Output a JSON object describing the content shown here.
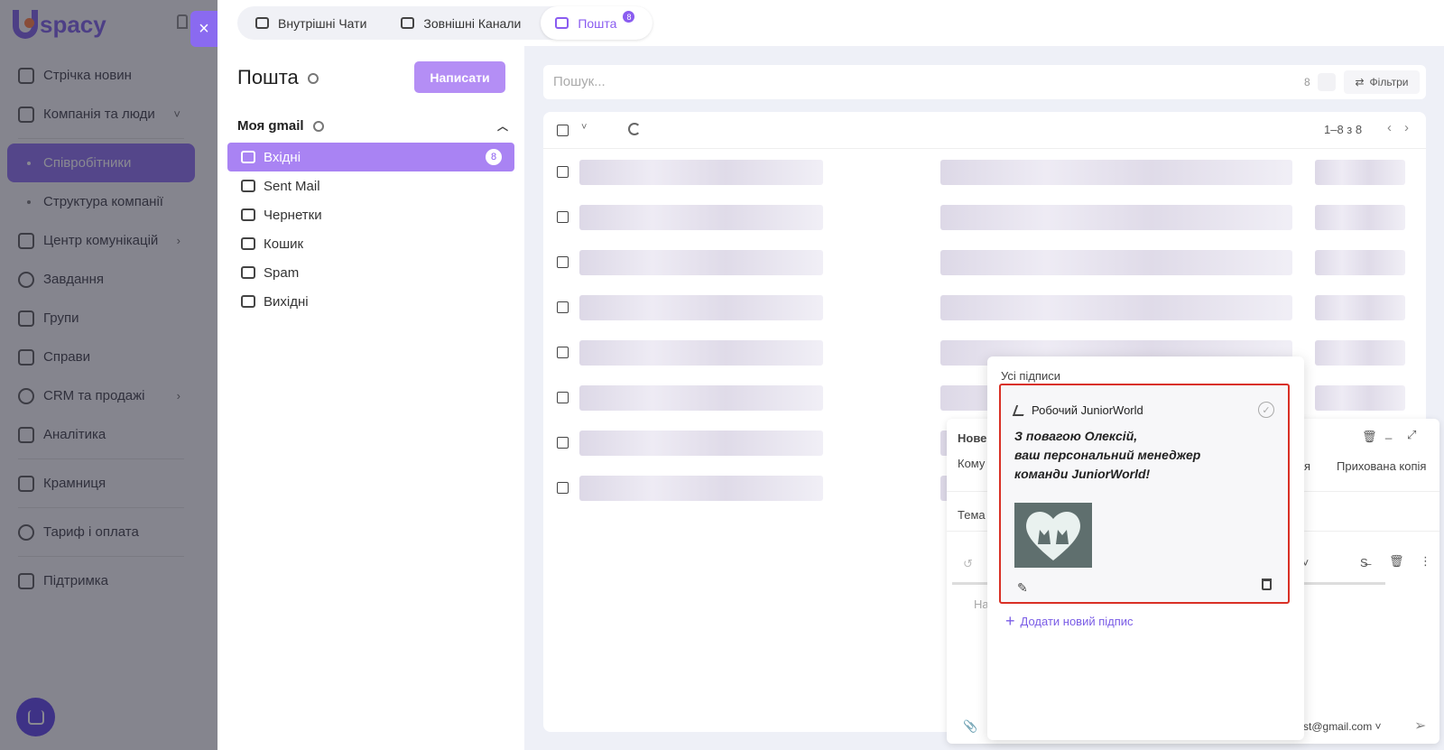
{
  "app": {
    "logo_text": "spacy",
    "nav": [
      {
        "label": "Стрічка новин",
        "type": "item"
      },
      {
        "label": "Компанія та люди",
        "type": "item",
        "chevron": "˅"
      },
      {
        "label": "Співробітники",
        "type": "sub",
        "active": true
      },
      {
        "label": "Структура компанії",
        "type": "sub"
      },
      {
        "label": "Центр комунікацій",
        "type": "item",
        "chevron": "›"
      },
      {
        "label": "Завдання",
        "type": "item"
      },
      {
        "label": "Групи",
        "type": "item"
      },
      {
        "label": "Справи",
        "type": "item"
      },
      {
        "label": "CRM та продажі",
        "type": "item",
        "chevron": "›"
      },
      {
        "label": "Аналітика",
        "type": "item"
      },
      {
        "label": "Крамниця",
        "type": "item"
      },
      {
        "label": "Тариф і оплата",
        "type": "item"
      },
      {
        "label": "Підтримка",
        "type": "item"
      }
    ],
    "close_icon": "×"
  },
  "tabs": [
    {
      "label": "Внутрішні Чати"
    },
    {
      "label": "Зовнішні Канали"
    },
    {
      "label": "Пошта",
      "badge": "8",
      "active": true
    }
  ],
  "mail": {
    "title": "Пошта",
    "compose_label": "Написати",
    "account": "Моя gmail",
    "folders": [
      {
        "label": "Вхідні",
        "count": "8",
        "active": true
      },
      {
        "label": "Sent Mail"
      },
      {
        "label": "Чернетки"
      },
      {
        "label": "Кошик"
      },
      {
        "label": "Spam"
      },
      {
        "label": "Вихідні"
      }
    ]
  },
  "search": {
    "placeholder": "Пошук...",
    "count": "8",
    "filters_label": "Фільтри"
  },
  "list": {
    "pager": "1–8 з 8",
    "rows": 8
  },
  "compose": {
    "title_partial": "Нове",
    "to_label": "Кому",
    "subject_label": "Тема",
    "body_placeholder_partial": "На",
    "cc_partial": "я",
    "bcc_label": "Прихована копія",
    "sender_partial": "st@gmail.com"
  },
  "signatures": {
    "title": "Усі підписи",
    "card": {
      "name": "Робочий JuniorWorld",
      "lines": [
        "З повагою Олексій,",
        "ваш персональний менеджер",
        "команди JuniorWorld!"
      ]
    },
    "add_label": "Додати новий підпис"
  },
  "colors": {
    "accent": "#8a5cf0",
    "highlight_border": "#d93025"
  }
}
